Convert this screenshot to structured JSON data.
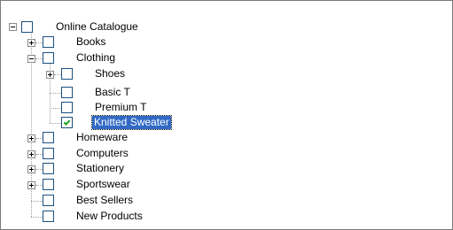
{
  "tree": {
    "root": {
      "label": "Online Catalogue",
      "expanded": true,
      "checked": false
    },
    "books": {
      "label": "Books",
      "expanded": false,
      "checked": false
    },
    "clothing": {
      "label": "Clothing",
      "expanded": true,
      "checked": false
    },
    "shoes": {
      "label": "Shoes",
      "expanded": false,
      "checked": false
    },
    "basic_t": {
      "label": "Basic T",
      "checked": false
    },
    "premium_t": {
      "label": "Premium T",
      "checked": false
    },
    "knitted_sweater": {
      "label": "Knitted Sweater",
      "checked": true,
      "selected": true
    },
    "homeware": {
      "label": "Homeware",
      "expanded": false,
      "checked": false
    },
    "computers": {
      "label": "Computers",
      "expanded": false,
      "checked": false
    },
    "stationery": {
      "label": "Stationery",
      "expanded": false,
      "checked": false
    },
    "sportswear": {
      "label": "Sportswear",
      "expanded": false,
      "checked": false
    },
    "best_sellers": {
      "label": "Best Sellers",
      "checked": false
    },
    "new_products": {
      "label": "New Products",
      "checked": false
    }
  },
  "colors": {
    "selection_bg": "#316ac5",
    "checkmark": "#21a121",
    "checkbox_border": "#1c5180"
  }
}
